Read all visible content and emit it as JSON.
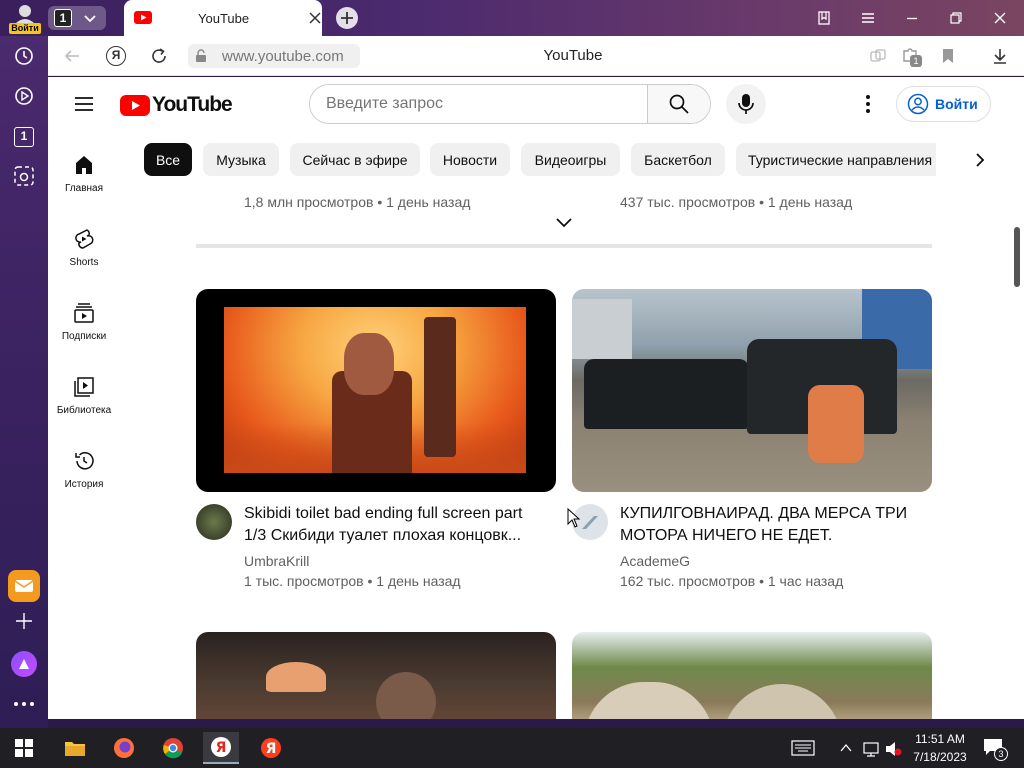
{
  "browser": {
    "login_label": "Войти",
    "tab_count": "1",
    "tab_title": "YouTube",
    "url": "www.youtube.com",
    "page_title": "YouTube",
    "extensions_badge": "1"
  },
  "youtube": {
    "logo_text": "YouTube",
    "search_placeholder": "Введите запрос",
    "signin_label": "Войти",
    "chips": [
      "Все",
      "Музыка",
      "Сейчас в эфире",
      "Новости",
      "Видеоигры",
      "Баскетбол",
      "Туристические направления"
    ],
    "nav": [
      {
        "label": "Главная",
        "icon": "home-icon"
      },
      {
        "label": "Shorts",
        "icon": "shorts-icon"
      },
      {
        "label": "Подписки",
        "icon": "subscriptions-icon"
      },
      {
        "label": "Библиотека",
        "icon": "library-icon"
      },
      {
        "label": "История",
        "icon": "history-icon"
      }
    ],
    "prev_row": [
      {
        "meta": "1,8 млн просмотров • 1 день назад"
      },
      {
        "meta": "437 тыс. просмотров • 1 день назад"
      }
    ],
    "videos": [
      {
        "title": "Skibidi toilet bad ending full screen part 1/3 Скибиди туалет плохая концовк...",
        "channel": "UmbraKrill",
        "meta": "1 тыс. просмотров • 1 день назад"
      },
      {
        "title": "КУПИЛГОВНАИРАД. ДВА МЕРСА ТРИ МОТОРА НИЧЕГО НЕ ЕДЕТ.",
        "channel": "AcademeG",
        "meta": "162 тыс. просмотров • 1 час назад"
      }
    ]
  },
  "taskbar": {
    "time": "11:51 AM",
    "date": "7/18/2023",
    "notifications": "3"
  },
  "colors": {
    "youtube_red": "#ff0000",
    "accent_blue": "#065fd4"
  }
}
